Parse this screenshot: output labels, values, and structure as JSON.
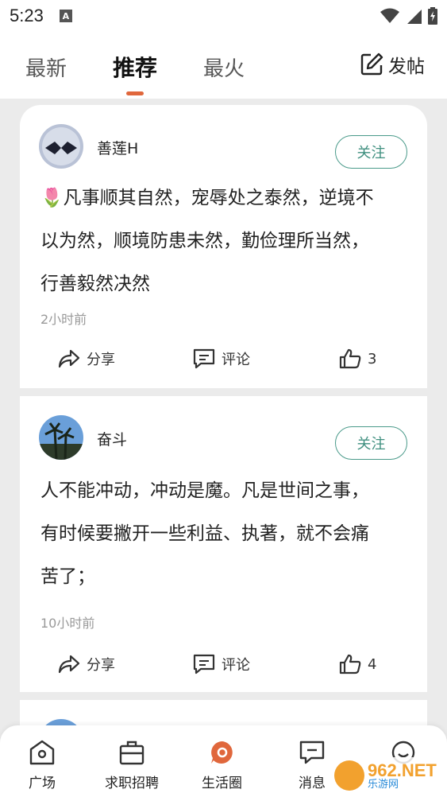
{
  "status_bar": {
    "time": "5:23",
    "notification_letter": "A"
  },
  "top_tabs": {
    "tabs": [
      {
        "label": "最新",
        "active": false
      },
      {
        "label": "推荐",
        "active": true
      },
      {
        "label": "最火",
        "active": false
      }
    ],
    "post_label": "发帖",
    "accent_color": "#e0673c"
  },
  "posts": [
    {
      "username": "善莲H",
      "follow_label": "关注",
      "content_lines": [
        "🌷凡事顺其自然，宠辱处之泰然，逆境不",
        "以为然，顺境防患未然，勤俭理所当然，",
        "行善毅然决然"
      ],
      "time": "2小时前",
      "share_label": "分享",
      "comment_label": "评论",
      "likes": "3"
    },
    {
      "username": "奋斗",
      "follow_label": "关注",
      "content_lines": [
        "人不能冲动，冲动是魔。凡是世间之事，",
        "有时候要撇开一些利益、执著，就不会痛",
        "苦了；"
      ],
      "time": "10小时前",
      "share_label": "分享",
      "comment_label": "评论",
      "likes": "4"
    }
  ],
  "bottom_nav": {
    "items": [
      {
        "label": "广场",
        "icon": "home-icon"
      },
      {
        "label": "求职招聘",
        "icon": "briefcase-icon"
      },
      {
        "label": "生活圈",
        "icon": "life-circle-icon",
        "active": true
      },
      {
        "label": "消息",
        "icon": "message-icon"
      },
      {
        "label": "",
        "icon": "profile-icon"
      }
    ],
    "active_color": "#e0673c"
  },
  "watermark": {
    "number": "962.NET",
    "sub": "乐游网"
  },
  "colors": {
    "follow": "#3f8f7f",
    "background": "#ebebeb"
  }
}
